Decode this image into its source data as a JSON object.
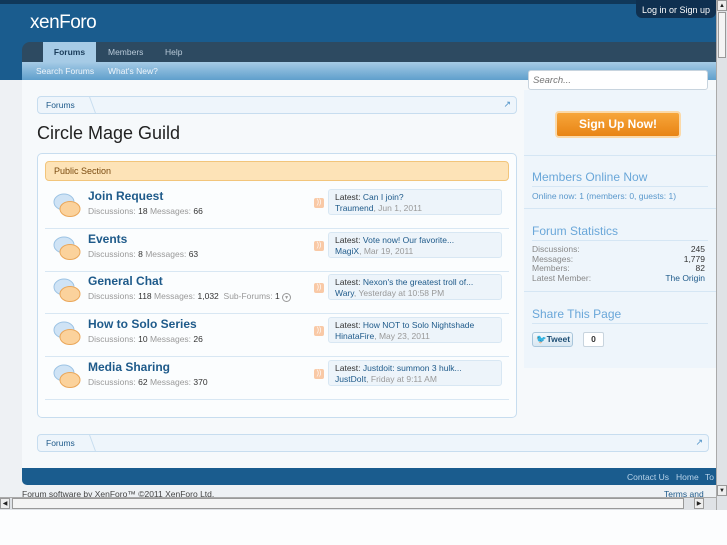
{
  "header": {
    "logo": "xenForo",
    "login": "Log in or Sign up"
  },
  "nav": {
    "tabs": [
      {
        "label": "Forums",
        "active": true
      },
      {
        "label": "Members"
      },
      {
        "label": "Help"
      }
    ],
    "sub": [
      "Search Forums",
      "What's New?"
    ]
  },
  "breadcrumb": {
    "top": "Forums",
    "bottom": "Forums"
  },
  "page_title": "Circle Mage Guild",
  "category": "Public Section",
  "labels": {
    "discussions": "Discussions:",
    "messages": "Messages:",
    "subforums": "Sub-Forums:",
    "latest": "Latest:"
  },
  "nodes": [
    {
      "name": "Join Request",
      "discussions": "18",
      "messages": "66",
      "latest_title": "Can I join?",
      "latest_user": "Traumend",
      "latest_date": ", Jun 1, 2011"
    },
    {
      "name": "Events",
      "discussions": "8",
      "messages": "63",
      "latest_title": "Vote now! Our favorite...",
      "latest_user": "MagiX",
      "latest_date": ", Mar 19, 2011"
    },
    {
      "name": "General Chat",
      "discussions": "118",
      "messages": "1,032",
      "subforums": "1",
      "latest_title": "Nexon's the greatest troll of...",
      "latest_user": "Wary",
      "latest_date": ", Yesterday at 10:58 PM"
    },
    {
      "name": "How to Solo Series",
      "discussions": "10",
      "messages": "26",
      "latest_title": "How NOT to Solo Nightshade",
      "latest_user": "HinataFire",
      "latest_date": ", May 23, 2011"
    },
    {
      "name": "Media Sharing",
      "discussions": "62",
      "messages": "370",
      "latest_title": "Justdoit: summon 3 hulk...",
      "latest_user": "JustDoIt",
      "latest_date": ", Friday at 9:11 AM"
    }
  ],
  "sidebar": {
    "search_placeholder": "Search...",
    "signup": "Sign Up Now!",
    "online_title": "Members Online Now",
    "online_text": "Online now: 1 (members: 0, guests: 1)",
    "stats_title": "Forum Statistics",
    "stats": [
      {
        "label": "Discussions:",
        "value": "245"
      },
      {
        "label": "Messages:",
        "value": "1,779"
      },
      {
        "label": "Members:",
        "value": "82"
      },
      {
        "label": "Latest Member:",
        "value": "The Origin"
      }
    ],
    "share_title": "Share This Page",
    "tweet": "Tweet",
    "tweet_count": "0"
  },
  "footer": {
    "links": [
      "Contact Us",
      "Home",
      "To"
    ],
    "copyright": "Forum software by XenForo™ ©2011 XenForo Ltd.",
    "terms": "Terms and Ru"
  },
  "colors": {
    "brand": "#1a5c8e",
    "accent": "#e88414"
  }
}
